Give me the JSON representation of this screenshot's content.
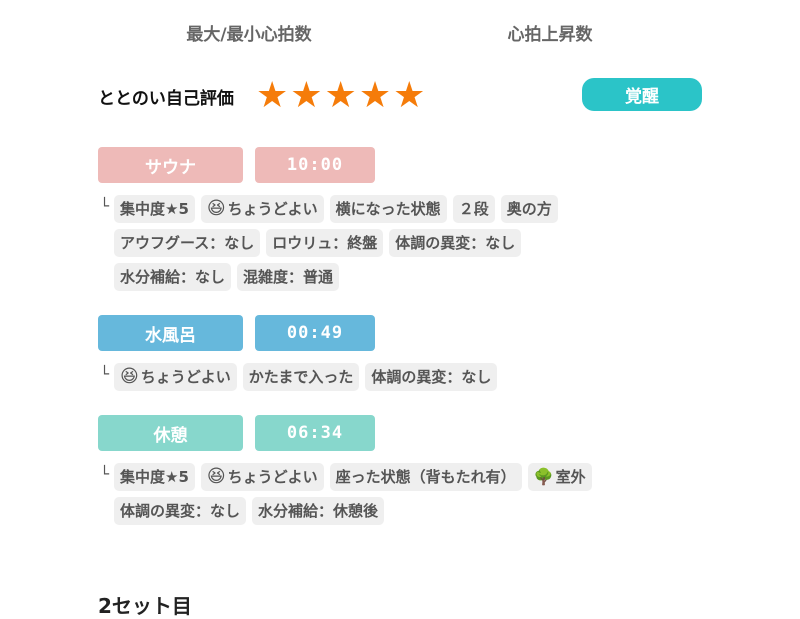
{
  "heart_rate": {
    "max_min_label": "最大/最小心拍数",
    "rise_label": "心拍上昇数"
  },
  "evaluation": {
    "label": "ととのい自己評価",
    "stars": "★★★★★",
    "rating": 5,
    "badge": "覚醒",
    "badge_color": "#2bc4c8",
    "star_color": "#f57c0a"
  },
  "branch_glyph": "└",
  "sections": {
    "sauna": {
      "name": "サウナ",
      "time": "10:00",
      "color": "#eebab8",
      "tags": [
        "集中度★5",
        "ちょうどよい",
        "横になった状態",
        "２段",
        "奥の方",
        "アウフグース：なし",
        "ロウリュ：終盤",
        "体調の異変：なし",
        "水分補給：なし",
        "混雑度：普通"
      ]
    },
    "mizuburo": {
      "name": "水風呂",
      "time": "00:49",
      "color": "#66b8dc",
      "tags": [
        "ちょうどよい",
        "かたまで入った",
        "体調の異変：なし"
      ]
    },
    "kyukei": {
      "name": "休憩",
      "time": "06:34",
      "color": "#87d7cc",
      "tags": [
        "集中度★5",
        "ちょうどよい",
        "座った状態（背もたれ有）",
        "室外",
        "体調の異変：なし",
        "水分補給：休憩後"
      ]
    }
  },
  "icons": {
    "grin": "grinning-squinting-face-icon",
    "tree": "tree-icon"
  },
  "next_cut_label": "2セット目"
}
